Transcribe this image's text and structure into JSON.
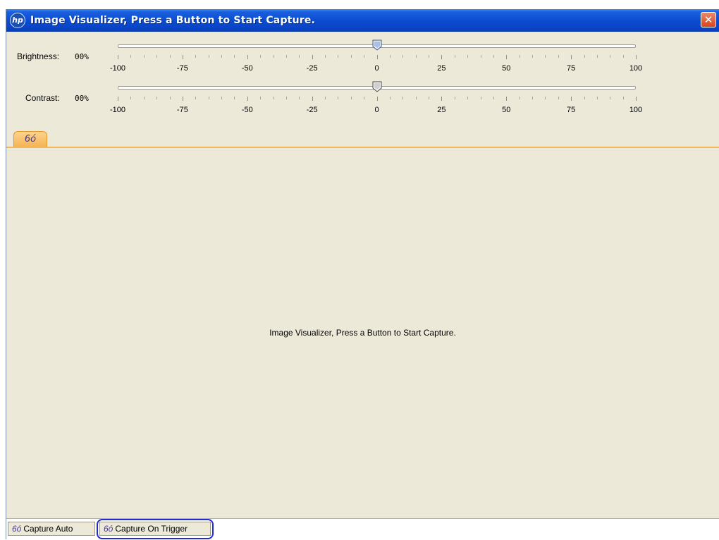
{
  "window": {
    "title": "Image Visualizer, Press a Button to Start Capture.",
    "logo": "hp",
    "close_glyph": "✕"
  },
  "sliders": {
    "brightness": {
      "label": "Brightness:",
      "value_text": "00%",
      "value": 0,
      "min": -100,
      "max": 100
    },
    "contrast": {
      "label": "Contrast:",
      "value_text": "00%",
      "value": 0,
      "min": -100,
      "max": 100
    },
    "tick_labels": [
      "-100",
      "-75",
      "-50",
      "-25",
      "0",
      "25",
      "50",
      "75",
      "100"
    ]
  },
  "viewer": {
    "tab_icon": "glasses-icon",
    "tab_glyph": "6ó",
    "message": "Image Visualizer, Press a Button to Start Capture."
  },
  "bottom_tabs": [
    {
      "label": "Capture Auto",
      "icon": "glasses-icon",
      "glyph": "6ó"
    },
    {
      "label": "Capture On Trigger",
      "icon": "glasses-icon",
      "glyph": "6ó"
    }
  ],
  "colors": {
    "titlebar": "#0a4ad0",
    "background": "#ece9d8",
    "tab_accent": "#f6b454",
    "highlight": "#1f2bd8"
  }
}
